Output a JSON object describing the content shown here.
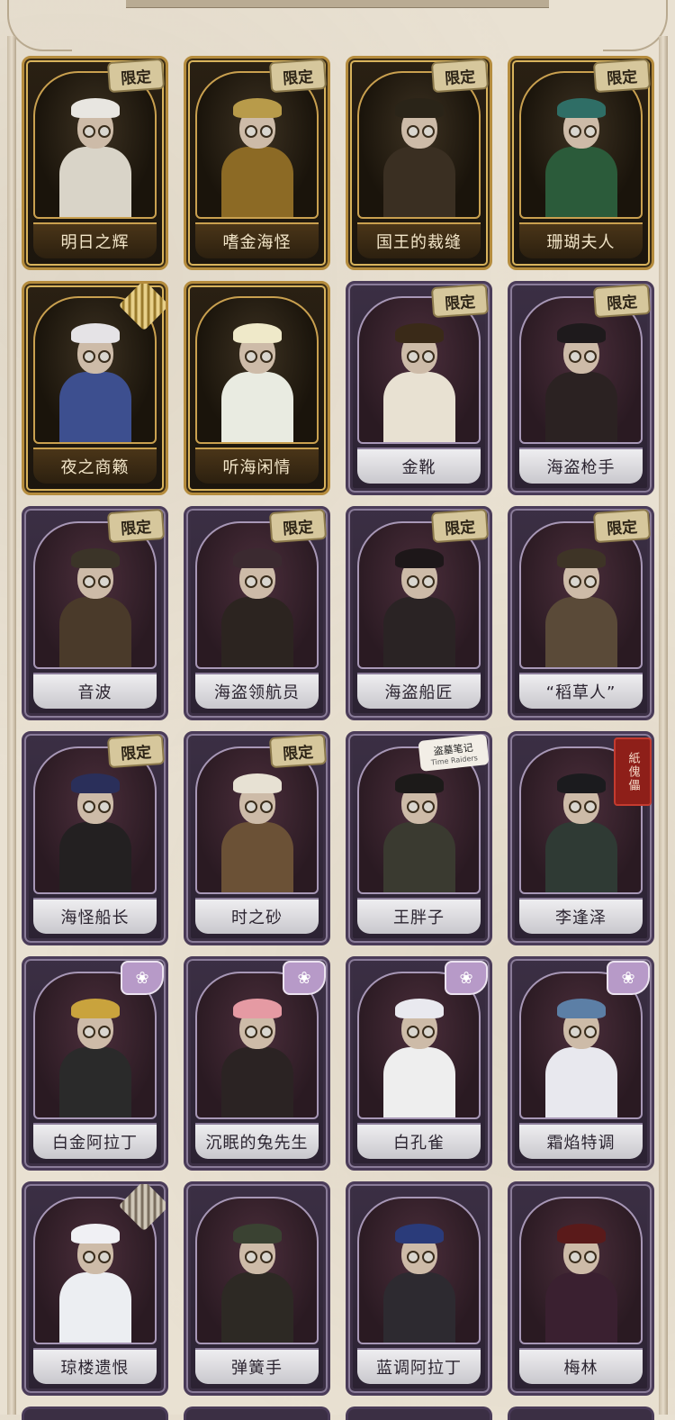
{
  "badges": {
    "limited": "限定",
    "seal": "紙傀儡",
    "logo_title": "盗墓笔记",
    "logo_sub": "Time Raiders"
  },
  "cards": [
    {
      "name": "明日之辉",
      "frame": "gold",
      "badge": "limited",
      "hat": "#e8e6e1",
      "body": "#d9d4c8"
    },
    {
      "name": "嗜金海怪",
      "frame": "gold",
      "badge": "limited",
      "hat": "#b89b4a",
      "body": "#8c6a25"
    },
    {
      "name": "国王的裁缝",
      "frame": "gold",
      "badge": "limited",
      "hat": "#2a2418",
      "body": "#3a2f22"
    },
    {
      "name": "珊瑚夫人",
      "frame": "gold",
      "badge": "limited",
      "hat": "#2f6e66",
      "body": "#2b5b3a"
    },
    {
      "name": "夜之商籁",
      "frame": "gold",
      "badge": "stripe-gold",
      "hat": "#e5e3e6",
      "body": "#3d4f8f"
    },
    {
      "name": "听海闲情",
      "frame": "gold",
      "badge": "none",
      "hat": "#efe9c9",
      "body": "#e9ebe1"
    },
    {
      "name": "金靴",
      "frame": "purple",
      "badge": "limited",
      "hat": "#3a2a18",
      "body": "#e8e1d2"
    },
    {
      "name": "海盗枪手",
      "frame": "purple",
      "badge": "limited",
      "hat": "#1e1a1c",
      "body": "#2b2222"
    },
    {
      "name": "音波",
      "frame": "purple",
      "badge": "limited",
      "hat": "#3b3428",
      "body": "#4a3a2a"
    },
    {
      "name": "海盗领航员",
      "frame": "purple",
      "badge": "limited",
      "hat": "#3b2a30",
      "body": "#2c2420"
    },
    {
      "name": "海盗船匠",
      "frame": "purple",
      "badge": "limited",
      "hat": "#1d1719",
      "body": "#2a2324"
    },
    {
      "name": "“稻草人”",
      "frame": "purple",
      "badge": "limited",
      "hat": "#3e3426",
      "body": "#5a4a38"
    },
    {
      "name": "海怪船长",
      "frame": "purple",
      "badge": "limited",
      "hat": "#2a2f5a",
      "body": "#232021"
    },
    {
      "name": "时之砂",
      "frame": "purple",
      "badge": "limited",
      "hat": "#e7e1d3",
      "body": "#6b5136"
    },
    {
      "name": "王胖子",
      "frame": "purple",
      "badge": "logo",
      "hat": "#1c1a19",
      "body": "#3a3a30"
    },
    {
      "name": "李逢泽",
      "frame": "purple",
      "badge": "seal",
      "hat": "#1b1b1e",
      "body": "#2f3a34"
    },
    {
      "name": "白金阿拉丁",
      "frame": "purple",
      "badge": "flower",
      "hat": "#c9a33d",
      "body": "#2a2a2a"
    },
    {
      "name": "沉眠的兔先生",
      "frame": "purple",
      "badge": "flower",
      "hat": "#e59aa3",
      "body": "#2b2323"
    },
    {
      "name": "白孔雀",
      "frame": "purple",
      "badge": "flower",
      "hat": "#e9e9ef",
      "body": "#eeeeee"
    },
    {
      "name": "霜焰特调",
      "frame": "purple",
      "badge": "flower",
      "hat": "#5c7fa6",
      "body": "#e8e8ee"
    },
    {
      "name": "琼楼遗恨",
      "frame": "purple",
      "badge": "stripe",
      "hat": "#f0f0f4",
      "body": "#eceef2"
    },
    {
      "name": "弹簧手",
      "frame": "purple",
      "badge": "none",
      "hat": "#3a4232",
      "body": "#2d2924"
    },
    {
      "name": "蓝调阿拉丁",
      "frame": "purple",
      "badge": "none",
      "hat": "#2a3b7a",
      "body": "#2d2a30"
    },
    {
      "name": "梅林",
      "frame": "purple",
      "badge": "none",
      "hat": "#5a1a1a",
      "body": "#3a2030"
    }
  ]
}
